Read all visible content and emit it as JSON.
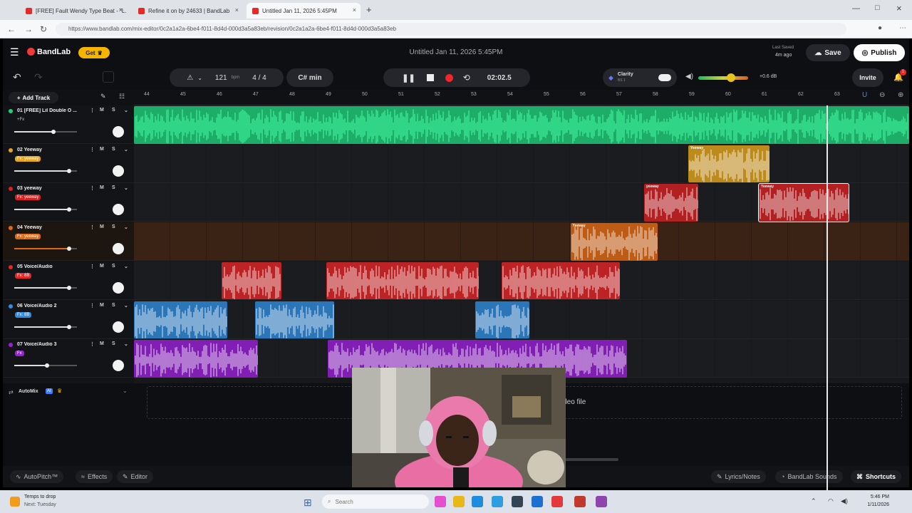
{
  "browser": {
    "tabs": [
      {
        "label": "[FREE] Fault Wendy Type Beat - \"L...",
        "fav_color": "#e32b2b"
      },
      {
        "label": "Refine it on by 24633 | BandLab",
        "fav_color": "#e32b2b"
      },
      {
        "label": "Untitled Jan 11, 2026 5:45PM",
        "fav_color": "#e32b2b"
      }
    ],
    "new_tab": "+",
    "url": "https://www.bandlab.com/mix-editor/0c2a1a2a-6be4-f011-8d4d-000d3a5a83eb/revision/0c2a1a2a-6be4-f011-8d4d-000d3a5a83eb"
  },
  "app": {
    "brand": "BandLab",
    "get_label": "Get",
    "project_title": "Untitled Jan 11, 2026 5:45PM",
    "last_saved_label": "Last Saved",
    "last_saved_time": "4m ago",
    "save_label": "Save",
    "publish_label": "Publish",
    "invite_label": "Invite",
    "notif_count": "1",
    "tempo_value": "121",
    "tempo_unit": "bpm",
    "time_signature": "4 / 4",
    "key_label": "C# min",
    "time_display": "02:02.5",
    "clarity_label": "Clarity",
    "clarity_sub": "BS 1",
    "master_db": "+0.6 dB",
    "add_track_label": "Add Track",
    "ruler": [
      "44",
      "45",
      "46",
      "47",
      "48",
      "49",
      "50",
      "51",
      "52",
      "53",
      "54",
      "55",
      "56",
      "57",
      "58",
      "59",
      "60",
      "61",
      "62",
      "63"
    ],
    "automix_label": "AutoMix",
    "automix_badge": "AI",
    "drop_text": "Drop a loop or an audio/MIDI/video file",
    "bottom": {
      "autopitch": "AutoPitch™",
      "effects": "Effects",
      "editor": "Editor",
      "lyrics": "Lyrics/Notes",
      "sounds": "BandLab Sounds",
      "shortcuts": "Shortcuts"
    }
  },
  "tracks": [
    {
      "name": "01 [FREE] Lil Double O ...",
      "fx": "+Fx",
      "color": "#1fd27a",
      "volume": 0.62
    },
    {
      "name": "02 Yeeway",
      "fx": "Fx: yeeway",
      "color": "#e6a61c",
      "volume": 0.88
    },
    {
      "name": "03 yeeway",
      "fx": "Fx: yeeway",
      "color": "#d82222",
      "volume": 0.88
    },
    {
      "name": "04 Yeeway",
      "fx": "Fx: yeeway",
      "color": "#e06a14",
      "volume": 0.88
    },
    {
      "name": "05 Voice/Audio",
      "fx": "Fx: 8B",
      "color": "#e62525",
      "volume": 0.88
    },
    {
      "name": "06 Voice/Audio 2",
      "fx": "Fx: 8B",
      "color": "#2f8ce0",
      "volume": 0.88
    },
    {
      "name": "07 Voice/Audio 3",
      "fx": "Fx",
      "color": "#9b1fd8",
      "volume": 0.52
    }
  ],
  "clips": [
    {
      "track": 0,
      "name": "",
      "start": 0.0,
      "end": 1.0
    },
    {
      "track": 1,
      "name": "Yeeway",
      "start": 0.715,
      "end": 0.82
    },
    {
      "track": 2,
      "name": "yeeway",
      "start": 0.658,
      "end": 0.728
    },
    {
      "track": 2,
      "name": "Yeeway",
      "start": 0.806,
      "end": 0.922
    },
    {
      "track": 3,
      "name": "Yeeway",
      "start": 0.563,
      "end": 0.676
    },
    {
      "track": 4,
      "name": "",
      "start": 0.113,
      "end": 0.19
    },
    {
      "track": 4,
      "name": "",
      "start": 0.248,
      "end": 0.445
    },
    {
      "track": 4,
      "name": "",
      "start": 0.474,
      "end": 0.627
    },
    {
      "track": 5,
      "name": "",
      "start": 0.0,
      "end": 0.12
    },
    {
      "track": 5,
      "name": "",
      "start": 0.156,
      "end": 0.258
    },
    {
      "track": 5,
      "name": "",
      "start": 0.44,
      "end": 0.51
    },
    {
      "track": 6,
      "name": "",
      "start": 0.0,
      "end": 0.16
    },
    {
      "track": 6,
      "name": "",
      "start": 0.25,
      "end": 0.636
    }
  ],
  "taskbar": {
    "weather_line1": "Temps to drop",
    "weather_line2": "Next: Tuesday",
    "search_placeholder": "Search",
    "time": "5:46 PM",
    "date": "1/11/2026"
  }
}
